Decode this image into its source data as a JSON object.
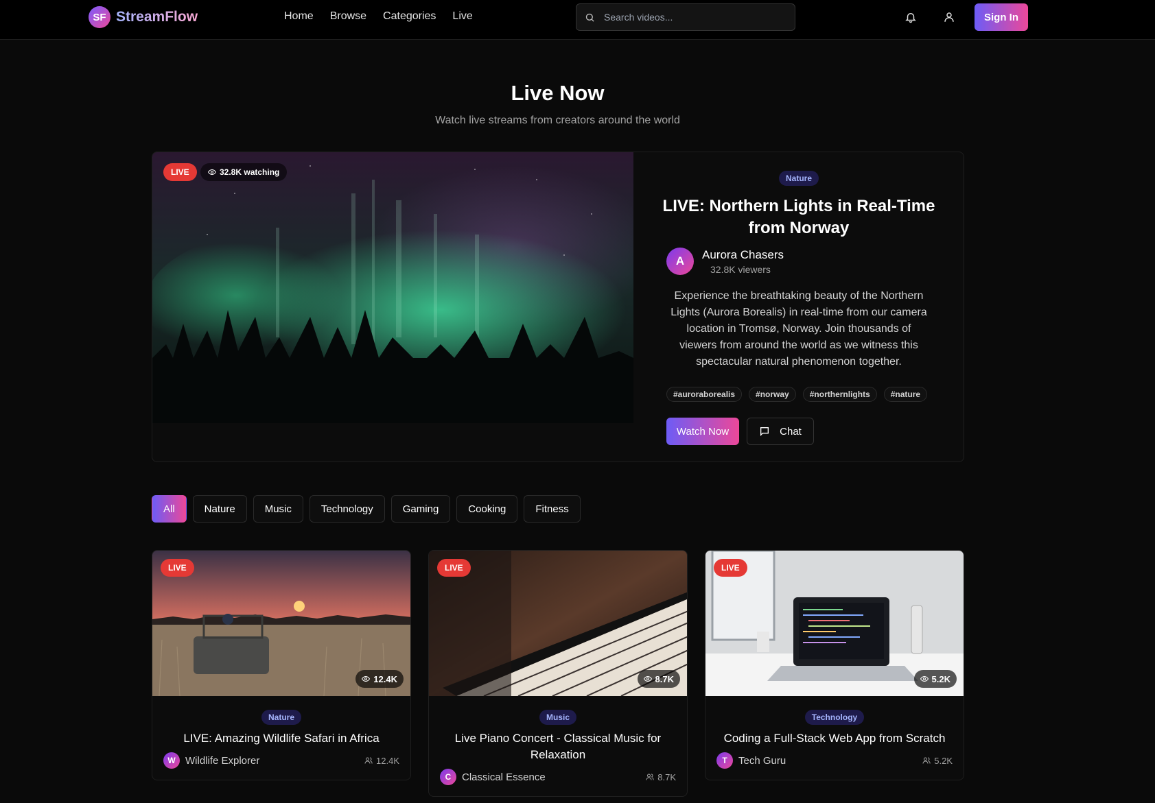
{
  "brand": {
    "mark": "SF",
    "name": "StreamFlow"
  },
  "nav": {
    "links": [
      "Home",
      "Browse",
      "Categories",
      "Live"
    ],
    "signin": "Sign In"
  },
  "search": {
    "placeholder": "Search videos...",
    "icon": "search-icon"
  },
  "header_icons": [
    "bell-icon",
    "user-icon"
  ],
  "hero": {
    "title": "Live Now",
    "subtitle": "Watch live streams from creators around the world"
  },
  "featured": {
    "live": "LIVE",
    "watching": "32.8K watching",
    "category": "Nature",
    "title": "LIVE: Northern Lights in Real-Time from Norway",
    "creator": {
      "initial": "A",
      "name": "Aurora Chasers",
      "viewers": "32.8K viewers"
    },
    "description": "Experience the breathtaking beauty of the Northern Lights (Aurora Borealis) in real-time from our camera location in Tromsø, Norway. Join thousands of viewers from around the world as we witness this spectacular natural phenomenon together.",
    "tags": [
      "#auroraborealis",
      "#norway",
      "#northernlights",
      "#nature"
    ],
    "watch_label": "Watch Now",
    "chat_label": "Chat"
  },
  "filters": [
    "All",
    "Nature",
    "Music",
    "Technology",
    "Gaming",
    "Cooking",
    "Fitness"
  ],
  "active_filter": "All",
  "cards": [
    {
      "live": "LIVE",
      "views": "12.4K",
      "category": "Nature",
      "title": "LIVE: Amazing Wildlife Safari in Africa",
      "initial": "W",
      "creator": "Wildlife Explorer",
      "count": "12.4K"
    },
    {
      "live": "LIVE",
      "views": "8.7K",
      "category": "Music",
      "title": "Live Piano Concert - Classical Music for Relaxation",
      "initial": "C",
      "creator": "Classical Essence",
      "count": "8.7K"
    },
    {
      "live": "LIVE",
      "views": "5.2K",
      "category": "Technology",
      "title": "Coding a Full-Stack Web App from Scratch",
      "initial": "T",
      "creator": "Tech Guru",
      "count": "5.2K"
    }
  ],
  "colors": {
    "accent_start": "#6d5cf6",
    "accent_end": "#ec4899",
    "live": "#e53935",
    "category_bg": "#1e1b4b",
    "category_text": "#a5b4fc"
  }
}
